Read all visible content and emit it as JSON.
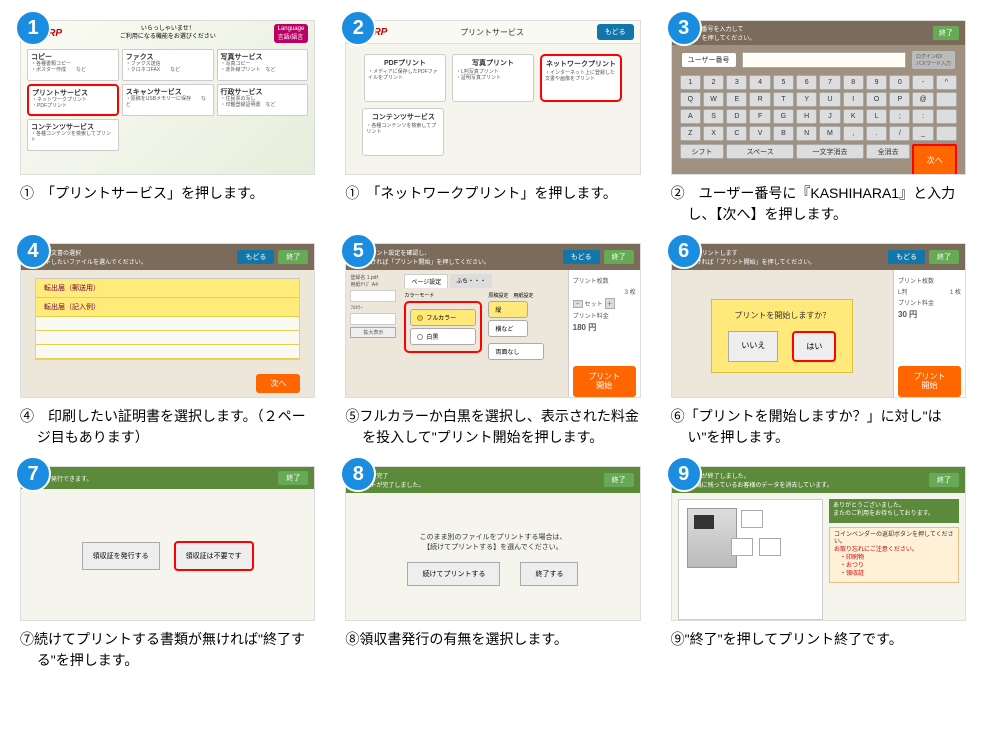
{
  "cells": [
    {
      "badge": "1",
      "caption": "①　「プリントサービス」を押します。",
      "s1": {
        "brand": "SHARP",
        "title": "いらっしゃいませ！\nご利用になる機能をお選びください",
        "langBtn": "Language\n言語/語言",
        "cards": [
          {
            "t": "コピー",
            "s": "・各種書類コピー\n・ポスター作成　　など"
          },
          {
            "t": "ファクス",
            "s": "・ファクス送信\n・クロネコFAX　　など"
          },
          {
            "t": "写真サービス",
            "s": "・写真コピー\n・赤外線プリント　など"
          },
          {
            "t": "プリントサービス",
            "s": "・ネットワークプリント\n・PDFプリント",
            "hl": true
          },
          {
            "t": "スキャンサービス",
            "s": "・原稿をUSBメモリーに保存　　など"
          },
          {
            "t": "行政サービス",
            "s": "・住民票の写し\n・印鑑登録証明書　など"
          },
          {
            "t": "コンテンツサービス",
            "s": "・各種コンテンツを検索してプリント"
          }
        ]
      }
    },
    {
      "badge": "2",
      "caption": "①　「ネットワークプリント」を押します。",
      "s2": {
        "brand": "SHARP",
        "title": "プリントサービス",
        "back": "もどる",
        "row1": [
          {
            "t": "PDFプリント",
            "s": "・メディアに保存したPDFファイルをプリント"
          },
          {
            "t": "写真プリント",
            "s": "・L判写真プリント\n・証明写真プリント"
          },
          {
            "t": "ネットワークプリント",
            "s": "・インターネット上に登録した文書や画像をプリント",
            "hl": true
          }
        ],
        "row2": [
          {
            "t": "コンテンツサービス",
            "s": "・各種コンテンツを検索してプリント"
          }
        ]
      }
    },
    {
      "badge": "3",
      "caption": "②　ユーザー番号に『KASHIHARA1』と入力し、【次へ】を押します。",
      "s3": {
        "hdr": "ユーザー番号を入力して\n「次へ」を押してください。",
        "end": "終了",
        "label": "ユーザー番号",
        "login": "ログインID/\nパスワード入力",
        "rowNum": [
          "1",
          "2",
          "3",
          "4",
          "5",
          "6",
          "7",
          "8",
          "9",
          "0",
          "-",
          "^"
        ],
        "rowQ": [
          "Q",
          "W",
          "E",
          "R",
          "T",
          "Y",
          "U",
          "I",
          "O",
          "P",
          "@"
        ],
        "rowA": [
          "A",
          "S",
          "D",
          "F",
          "G",
          "H",
          "J",
          "K",
          "L",
          ";",
          ":"
        ],
        "rowZ": [
          "Z",
          "X",
          "C",
          "V",
          "B",
          "N",
          "M",
          ",",
          ".",
          "/",
          "_"
        ],
        "shift": "シフト",
        "space": "スペース",
        "clear": "一文字消去",
        "allclear": "全消去",
        "next": "次へ"
      }
    },
    {
      "badge": "4",
      "caption": "④　印刷したい証明書を選択します。（２ページ目もあります）",
      "s4": {
        "hdr": "プリント文書の選択\nプリントしたいファイルを選んでください。",
        "back": "もどる",
        "end": "終了",
        "rows": [
          "転出届（郵送用）",
          "転出届（記入例）"
        ],
        "next": "次へ"
      }
    },
    {
      "badge": "5",
      "caption": "⑤フルカラーか白黒を選択し、表示された料金を投入して\"プリント開始を押します。",
      "s5": {
        "hdr": "文書プリント設定を確認し、\nよろしければ「プリント開始」を押してください。",
        "back": "もどる",
        "end": "終了",
        "leftLabels": [
          "登録名",
          "用紙ｻｲｽﾞ",
          "ﾌﾙｶﾗｰ",
          "拡大表示"
        ],
        "leftVals": [
          "1.pdf",
          "A4"
        ],
        "tabs": [
          "ページ設定",
          "ふち・・・"
        ],
        "colorLabel": "カラーモード",
        "orientLabel": "原稿設定　用紙設定",
        "opt1": "フルカラー",
        "opt2": "白黒",
        "orient1": "縦",
        "orient2": "横など",
        "orient3": "両面なし",
        "info1": "プリント枚数",
        "info1v": "3 枚",
        "info3": "セット",
        "price": "180 円",
        "start": "プリント\n開始",
        "priceLabel": "プリント料金"
      }
    },
    {
      "badge": "6",
      "caption": "⑥「プリントを開始しますか？」に対し\"はい\"を押します。",
      "s6": {
        "hdr": "文書をプリントします\nよろしければ「プリント開始」を押してください。",
        "back": "もどる",
        "end": "終了",
        "q": "プリントを開始しますか？",
        "no": "いいえ",
        "yes": "はい",
        "info1": "プリント枚数",
        "info1v": "1 枚",
        "info2": "L判",
        "price": "30 円",
        "priceLabel": "プリント料金",
        "start": "プリント\n開始"
      }
    },
    {
      "badge": "7",
      "caption": "⑦続けてプリントする書類が無ければ\"終了する\"を押します。",
      "s7": {
        "hdr": "領収証を発行できます。",
        "end": "終了",
        "b1": "領収証を発行する",
        "b2": "領収証は不要です"
      }
    },
    {
      "badge": "8",
      "caption": "⑧領収書発行の有無を選択します。",
      "s8": {
        "hdr1": "プリント完了",
        "hdr2": "プリントが完了しました。",
        "end": "終了",
        "msg": "このまま別のファイルをプリントする場合は、\n【続けてプリントする】を選んでください。",
        "b1": "続けてプリントする",
        "b2": "終了する"
      }
    },
    {
      "badge": "9",
      "caption": "⑨\"終了\"を押してプリント終了です。",
      "s9": {
        "hdr1": "サービスが終了しました。",
        "hdr2": "コピー機に残っているお客様のデータを消去しています。",
        "end": "終了",
        "msg1": "ありがとうございました。\nまたのご利用をお待ちしております。",
        "msg2hd": "コインベンダーの返却ボタンを押してください。",
        "msg2": "お取り忘れにご注意ください。\n　・印刷物\n　・おつり\n　・領収証"
      }
    }
  ]
}
